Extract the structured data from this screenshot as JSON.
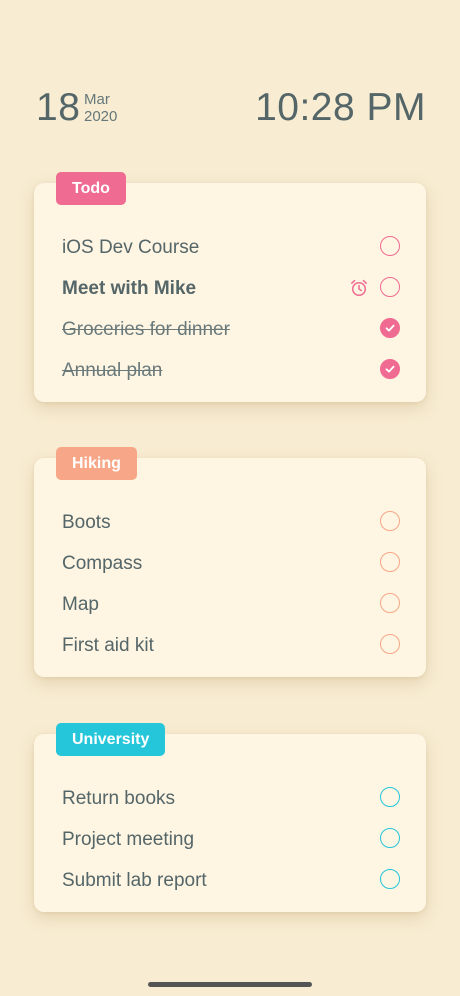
{
  "header": {
    "day": "18",
    "month": "Mar",
    "year": "2020",
    "time": "10:28 PM"
  },
  "colors": {
    "background": "#f8ecd2",
    "card": "#fef5e3",
    "text": "#546668",
    "todo": "#f06b91",
    "hiking": "#f7a787",
    "university": "#26c6da"
  },
  "lists": [
    {
      "name": "Todo",
      "color": "#f06b91",
      "items": [
        {
          "label": "iOS Dev Course",
          "done": false,
          "bold": false,
          "alarm": false
        },
        {
          "label": "Meet with Mike",
          "done": false,
          "bold": true,
          "alarm": true,
          "alarm_icon": "alarm-clock-icon"
        },
        {
          "label": "Groceries for dinner",
          "done": true,
          "bold": false,
          "alarm": false
        },
        {
          "label": "Annual plan",
          "done": true,
          "bold": false,
          "alarm": false
        }
      ]
    },
    {
      "name": "Hiking",
      "color": "#f7a787",
      "items": [
        {
          "label": "Boots",
          "done": false
        },
        {
          "label": "Compass",
          "done": false
        },
        {
          "label": "Map",
          "done": false
        },
        {
          "label": "First aid kit",
          "done": false
        }
      ]
    },
    {
      "name": "University",
      "color": "#26c6da",
      "items": [
        {
          "label": "Return books",
          "done": false
        },
        {
          "label": "Project meeting",
          "done": false
        },
        {
          "label": "Submit lab report",
          "done": false
        }
      ]
    }
  ]
}
